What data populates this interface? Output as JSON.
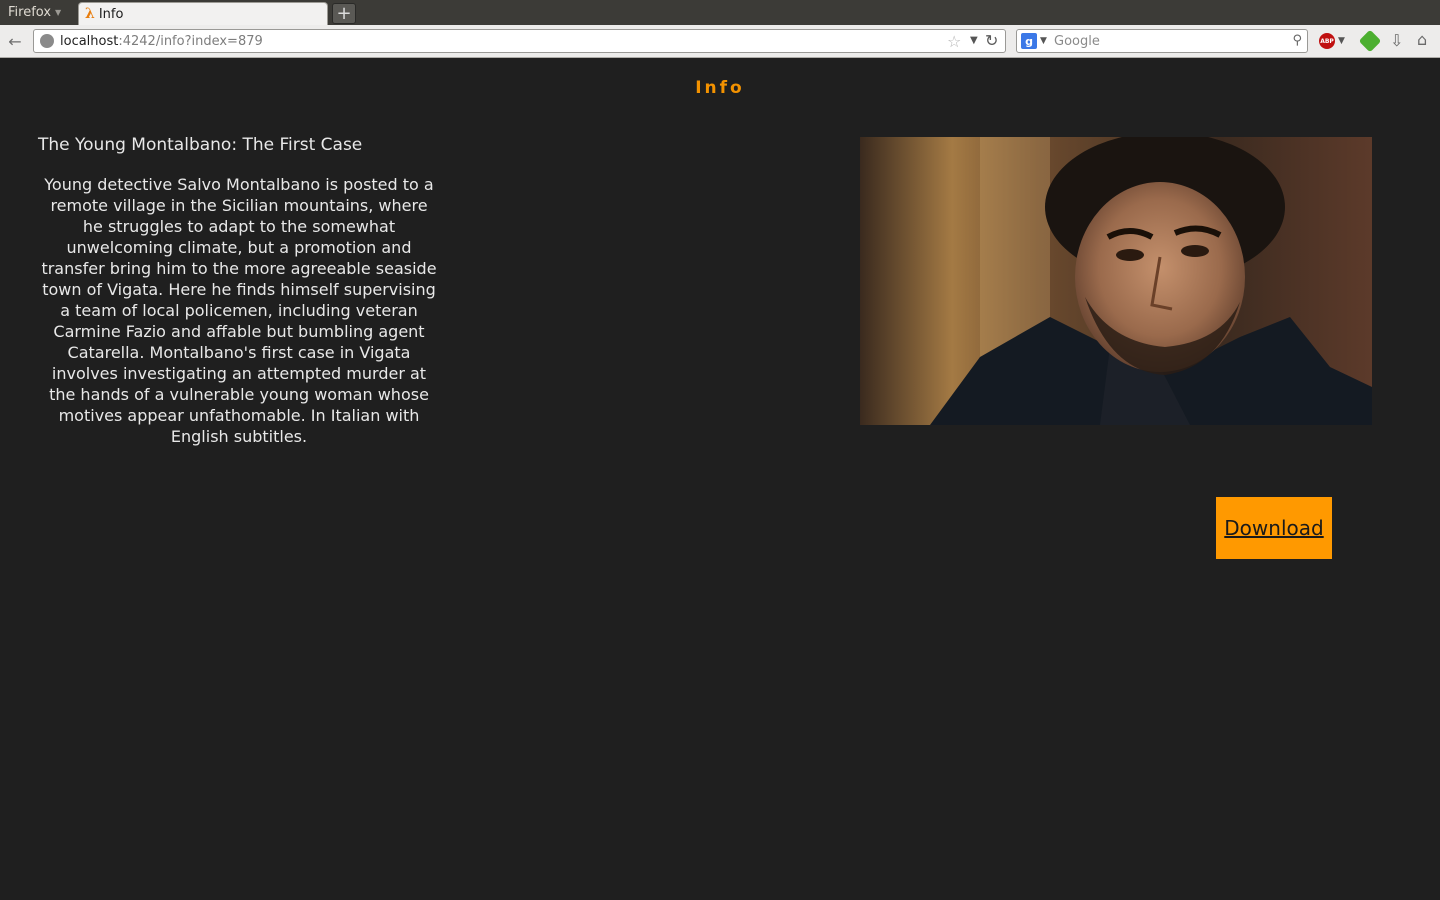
{
  "browser": {
    "menu_label": "Firefox",
    "tab": {
      "title": "Info",
      "icon": "lambda-icon"
    },
    "url": {
      "host": "localhost",
      "rest": ":4242/info?index=879"
    },
    "search": {
      "placeholder": "Google",
      "engine_letter": "g"
    },
    "extensions": {
      "abp_label": "ABP"
    }
  },
  "page": {
    "heading": "Info",
    "movie_title": "The Young Montalbano: The First Case",
    "description": "Young detective Salvo Montalbano is posted to a remote village in the Sicilian mountains, where he struggles to adapt to the somewhat unwelcoming climate, but a promotion and transfer bring him to the more agreeable seaside town of Vigata. Here he finds himself supervising a team of local policemen, including veteran Carmine Fazio and affable but bumbling agent Catarella. Montalbano's first case in Vigata involves investigating an attempted murder at the hands of a vulnerable young woman whose motives appear unfathomable. In Italian with English subtitles.",
    "download_label": "Download"
  },
  "colors": {
    "accent": "#ff9900",
    "heading": "#f39200",
    "background": "#1f1f1f",
    "text": "#e8e8e8"
  }
}
